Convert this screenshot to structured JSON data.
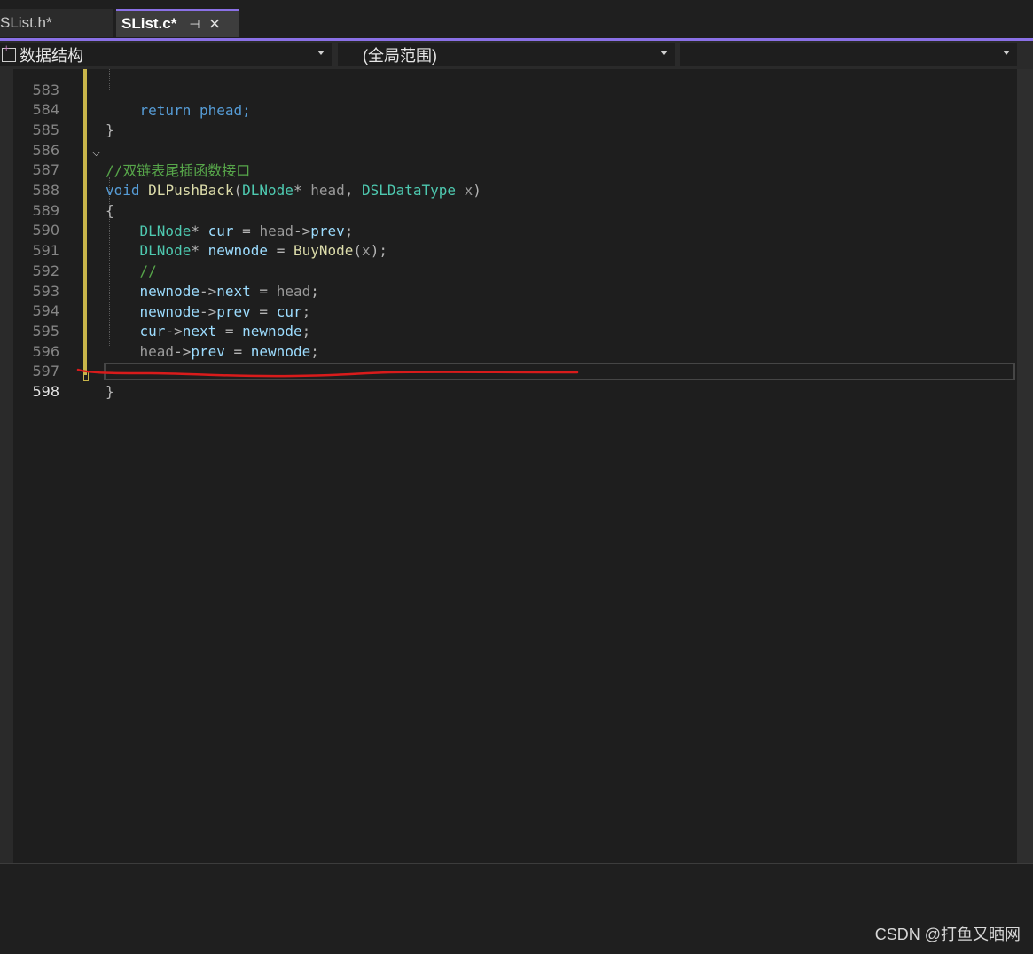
{
  "tabs": [
    {
      "label": "SList.h*",
      "active": false
    },
    {
      "label": "SList.c*",
      "active": true,
      "pin_icon": "pin-icon",
      "close_icon": "close-icon"
    }
  ],
  "navbar": {
    "project": "数据结构",
    "scope": "(全局范围)",
    "member": ""
  },
  "code_lines": [
    {
      "num": "583",
      "text": "    return phead;"
    },
    {
      "num": "584",
      "text": "}"
    },
    {
      "num": "585",
      "text": ""
    },
    {
      "num": "586",
      "text": "//双链表尾插函数接口"
    },
    {
      "num": "587",
      "text": "void DLPushBack(DLNode* head, DSLDataType x)"
    },
    {
      "num": "588",
      "text": "{"
    },
    {
      "num": "589",
      "text": "    DLNode* cur = head->prev;"
    },
    {
      "num": "590",
      "text": "    DLNode* newnode = BuyNode(x);"
    },
    {
      "num": "591",
      "text": "    //"
    },
    {
      "num": "592",
      "text": "    newnode->next = head;"
    },
    {
      "num": "593",
      "text": "    newnode->prev = cur;"
    },
    {
      "num": "594",
      "text": "    cur->next = newnode;"
    },
    {
      "num": "595",
      "text": "    head->prev = newnode;"
    },
    {
      "num": "596",
      "text": ""
    },
    {
      "num": "597",
      "text": "}"
    },
    {
      "num": "598",
      "text": ""
    }
  ],
  "current_line": "598",
  "colors": {
    "accent": "#8a70e6",
    "annotation_red": "#d81b1b",
    "change_margin": "#c8b54a"
  },
  "watermark": "CSDN @打鱼又晒网"
}
